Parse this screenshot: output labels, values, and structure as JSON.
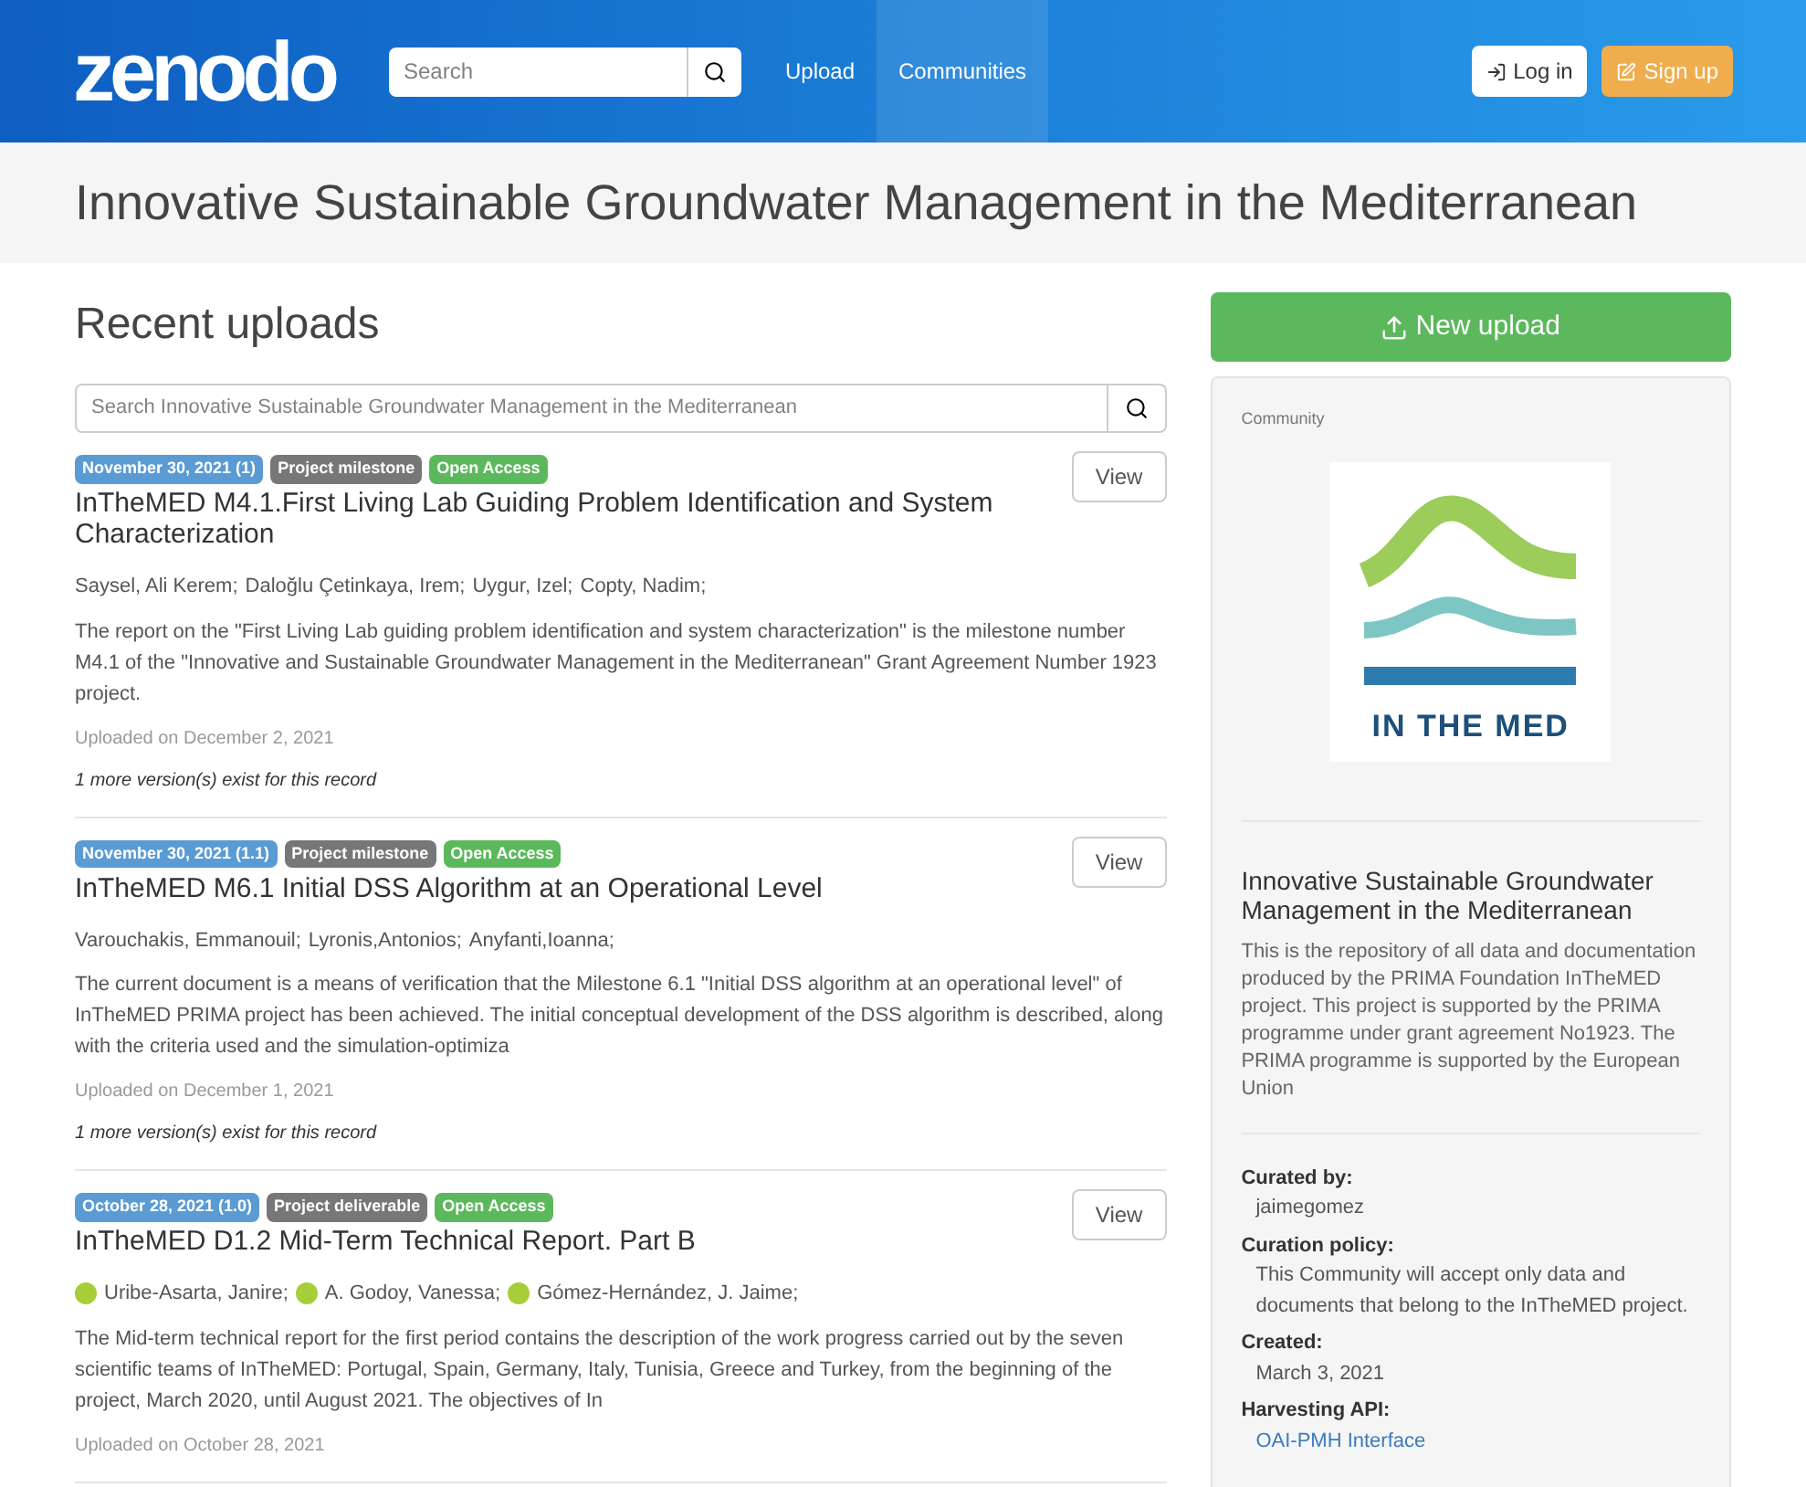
{
  "header": {
    "logo": "zenodo",
    "search": {
      "placeholder": "Search"
    },
    "nav": [
      {
        "label": "Upload",
        "selected": false
      },
      {
        "label": "Communities",
        "selected": true
      }
    ],
    "login": "Log in",
    "signup": "Sign up"
  },
  "page_title": "Innovative Sustainable Groundwater Management in the Mediterranean",
  "recent": {
    "heading": "Recent uploads",
    "search": {
      "placeholder": "Search Innovative Sustainable Groundwater Management in the Mediterranean"
    },
    "records": [
      {
        "badges": [
          {
            "kind": "date",
            "text": "November 30, 2021 (1)"
          },
          {
            "kind": "type",
            "text": "Project milestone"
          },
          {
            "kind": "access",
            "text": "Open Access"
          }
        ],
        "view": "View",
        "title": "InTheMED M4.1.First Living Lab Guiding Problem Identification and System Characterization",
        "authors": [
          {
            "name": "Saysel, Ali Kerem;",
            "orcid": false
          },
          {
            "name": "Daloğlu Çetinkaya, Irem;",
            "orcid": false
          },
          {
            "name": "Uygur, Izel;",
            "orcid": false
          },
          {
            "name": "Copty, Nadim;",
            "orcid": false
          }
        ],
        "description": "The report on the \"First Living Lab guiding problem identification and system characterization\" is the milestone number M4.1 of the \"Innovative and Sustainable Groundwater Management in the Mediterranean\" Grant Agreement Number 1923 project.",
        "uploaded": "Uploaded on December 2, 2021",
        "versions": "1 more version(s) exist for this record"
      },
      {
        "badges": [
          {
            "kind": "date",
            "text": "November 30, 2021 (1.1)"
          },
          {
            "kind": "type",
            "text": "Project milestone"
          },
          {
            "kind": "access",
            "text": "Open Access"
          }
        ],
        "view": "View",
        "title": "InTheMED M6.1 Initial DSS Algorithm at an Operational Level",
        "authors": [
          {
            "name": "Varouchakis, Emmanouil;",
            "orcid": false
          },
          {
            "name": "Lyronis,Antonios;",
            "orcid": false
          },
          {
            "name": "Anyfanti,Ioanna;",
            "orcid": false
          }
        ],
        "description": "The current document is a means of verification that the Milestone 6.1 \"Initial DSS algorithm at an operational level\" of InTheMED PRIMA project has been achieved. The initial conceptual development of the DSS algorithm is described, along with the criteria used and the simulation-optimiza",
        "uploaded": "Uploaded on December 1, 2021",
        "versions": "1 more version(s) exist for this record"
      },
      {
        "badges": [
          {
            "kind": "date",
            "text": "October 28, 2021 (1.0)"
          },
          {
            "kind": "type",
            "text": "Project deliverable"
          },
          {
            "kind": "access",
            "text": "Open Access"
          }
        ],
        "view": "View",
        "title": "InTheMED D1.2 Mid-Term Technical Report. Part B",
        "authors": [
          {
            "name": "Uribe-Asarta, Janire;",
            "orcid": true
          },
          {
            "name": "A. Godoy, Vanessa;",
            "orcid": true
          },
          {
            "name": "Gómez-Hernández, J. Jaime;",
            "orcid": true
          }
        ],
        "description": "The Mid-term technical report for the first period contains the description of the work progress carried out by the seven scientific teams of InTheMED: Portugal, Spain, Germany, Italy, Tunisia, Greece and Turkey, from the beginning of the project, March 2020, until August 2021. The objectives of In",
        "uploaded": "Uploaded on October 28, 2021"
      }
    ]
  },
  "sidebar": {
    "new_upload": "New upload",
    "label": "Community",
    "logo_text": "IN THE MED",
    "name": "Innovative Sustainable Groundwater Management in the Mediterranean",
    "description": "This is the repository of all data and documentation produced by the PRIMA Foundation InTheMED project. This project is supported by the PRIMA programme under grant agreement No1923. The PRIMA programme is supported by the European Union",
    "details": [
      {
        "term": "Curated by:",
        "value": "jaimegomez",
        "kind": "text"
      },
      {
        "term": "Curation policy:",
        "value": "This Community will accept only data and documents that belong to the InTheMED project.",
        "kind": "text"
      },
      {
        "term": "Created:",
        "value": "March 3, 2021",
        "kind": "text"
      },
      {
        "term": "Harvesting API:",
        "value": "OAI-PMH Interface",
        "kind": "link"
      }
    ]
  }
}
